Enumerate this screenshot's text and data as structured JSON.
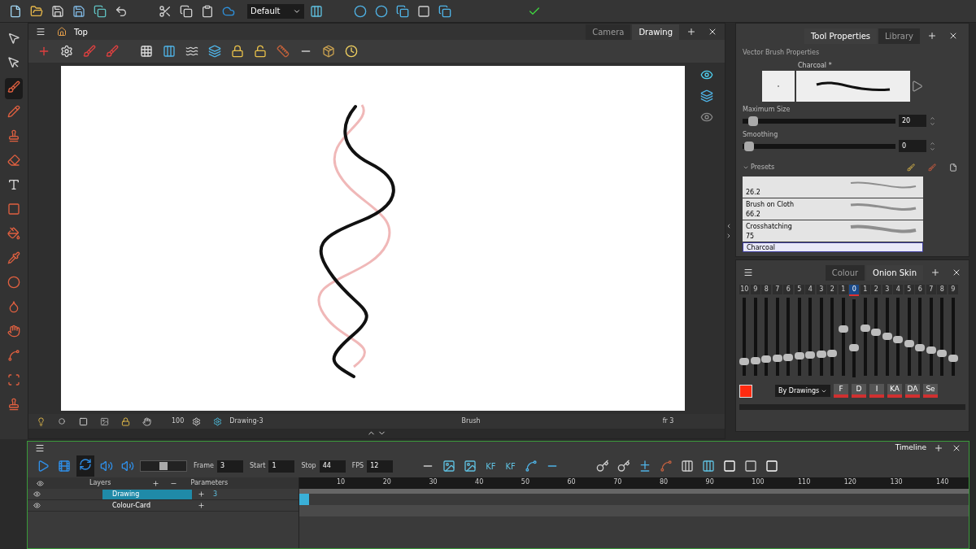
{
  "toolbar": {
    "workspace": "Default"
  },
  "camera_view": {
    "title": "Top",
    "tabs": [
      {
        "label": "Camera",
        "selected": false
      },
      {
        "label": "Drawing",
        "selected": true
      }
    ],
    "status": {
      "zoom": "100",
      "drawing": "Drawing-3",
      "tool": "Brush",
      "frame": "fr 3"
    }
  },
  "tool_properties": {
    "tabs": [
      {
        "label": "Tool Properties",
        "selected": true
      },
      {
        "label": "Library",
        "selected": false
      }
    ],
    "section": "Vector Brush Properties",
    "brush_name": "Charcoal *",
    "sliders": [
      {
        "label": "Maximum Size",
        "level": 0.03,
        "value": "20"
      },
      {
        "label": "Smoothing",
        "level": 0,
        "value": "0"
      }
    ],
    "presets_label": "Presets",
    "presets": [
      {
        "size": "26.2",
        "selected": false
      },
      {
        "name": "Brush on Cloth",
        "size": "66.2",
        "selected": false
      },
      {
        "name": "Crosshatching",
        "size": "75",
        "selected": false
      },
      {
        "name": "Charcoal",
        "selected": true
      }
    ]
  },
  "onion_skin": {
    "tabs": [
      {
        "label": "Colour",
        "selected": false
      },
      {
        "label": "Onion Skin",
        "selected": true
      }
    ],
    "frames": [
      {
        "label": "10",
        "level": 0.15,
        "current": false
      },
      {
        "label": "9",
        "level": 0.16,
        "current": false
      },
      {
        "label": "8",
        "level": 0.18,
        "current": false
      },
      {
        "label": "7",
        "level": 0.19,
        "current": false
      },
      {
        "label": "6",
        "level": 0.21,
        "current": false
      },
      {
        "label": "5",
        "level": 0.23,
        "current": false
      },
      {
        "label": "4",
        "level": 0.24,
        "current": false
      },
      {
        "label": "3",
        "level": 0.25,
        "current": false
      },
      {
        "label": "2",
        "level": 0.26,
        "current": false
      },
      {
        "label": "1",
        "level": 0.61,
        "current": false
      },
      {
        "label": "0",
        "level": 0.37,
        "current": true
      },
      {
        "label": "1",
        "level": 0.62,
        "current": false
      },
      {
        "label": "2",
        "level": 0.56,
        "current": false
      },
      {
        "label": "3",
        "level": 0.51,
        "current": false
      },
      {
        "label": "4",
        "level": 0.46,
        "current": false
      },
      {
        "label": "5",
        "level": 0.4,
        "current": false
      },
      {
        "label": "6",
        "level": 0.35,
        "current": false
      },
      {
        "label": "7",
        "level": 0.31,
        "current": false
      },
      {
        "label": "8",
        "level": 0.26,
        "current": false
      },
      {
        "label": "9",
        "level": 0.2,
        "current": false
      }
    ],
    "mode": "By Drawings",
    "buttons": [
      "F",
      "D",
      "I",
      "KA",
      "DA",
      "Se"
    ]
  },
  "timeline": {
    "title": "Timeline",
    "playback_speed": {
      "level": 0.5
    },
    "fields": [
      {
        "label": "Frame",
        "value": "3"
      },
      {
        "label": "Start",
        "value": "1"
      },
      {
        "label": "Stop",
        "value": "44"
      },
      {
        "label": "FPS",
        "value": "12"
      }
    ],
    "key_labels": [
      "KF",
      "KF"
    ],
    "layers_header": "Layers",
    "parameters_header": "Parameters",
    "layers": [
      {
        "name": "Drawing",
        "selected": true,
        "parameter": "3"
      },
      {
        "name": "Colour-Card",
        "selected": false
      }
    ],
    "ruler": [
      "10",
      "20",
      "30",
      "40",
      "50",
      "60",
      "70",
      "80",
      "90",
      "100",
      "110",
      "120",
      "130",
      "140"
    ]
  }
}
